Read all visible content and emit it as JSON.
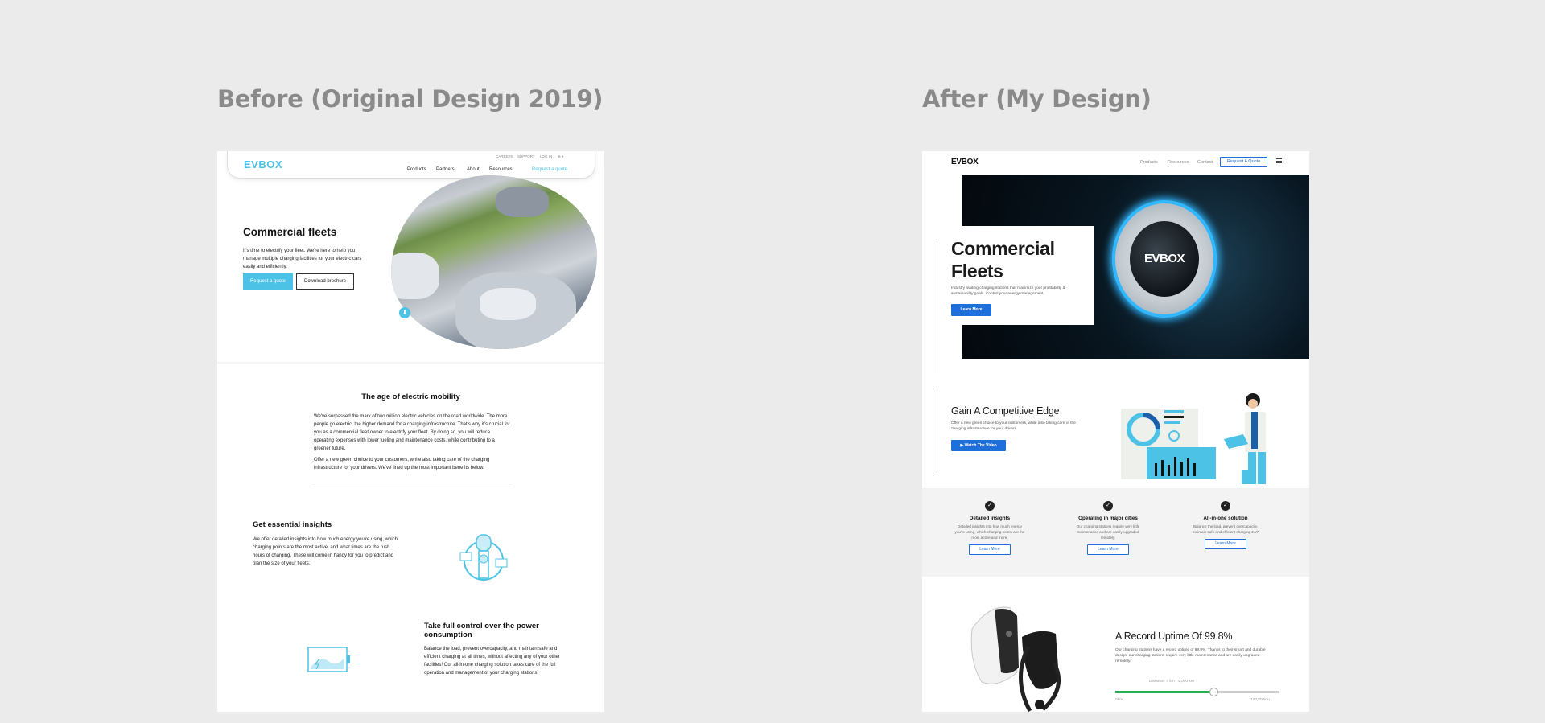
{
  "headings": {
    "before": "Before (Original Design 2019)",
    "after": "After (My Design)"
  },
  "before": {
    "nav": {
      "logo": "EVBOX",
      "utility": [
        "CAREERS",
        "SUPPORT",
        "LOG IN",
        "⊕ ▾"
      ],
      "menu": [
        "Products",
        "Partners",
        "About",
        "Resources",
        "Request a quote"
      ]
    },
    "hero": {
      "title": "Commercial fleets",
      "text": "It's time to electrify your fleet. We're here to help you manage multiple charging facilities for your electric cars easily and efficiently.",
      "primary_button": "Request a quote",
      "secondary_button": "Download brochure"
    },
    "age": {
      "title": "The age of electric mobility",
      "p1": "We've surpassed the mark of two million electric vehicles on the road worldwide. The more people go electric, the higher demand for a charging infrastructure. That's why it's crucial for you as a commercial fleet owner to electrify your fleet. By doing so, you will reduce operating expenses with lower fueling and maintenance costs, while contributing to a greener future.",
      "p2": "Offer a new green choice to your customers, while also taking care of the charging infrastructure for your drivers. We've lined up the most important benefits below."
    },
    "insights": {
      "title": "Get essential insights",
      "text": "We offer detailed insights into how much energy you're using, which charging points are the most active, and what times are the rush hours of charging. These will come in handy for you to predict and plan the size of your fleets."
    },
    "control": {
      "title": "Take full control over the power consumption",
      "text": "Balance the load, prevent overcapacity, and maintain safe and efficient charging at all times, without affecting any of your other facilities! Our all-in-one charging solution takes care of the full operation and management of your charging stations."
    }
  },
  "after": {
    "nav": {
      "logo": "EVBOX",
      "links": [
        "Products",
        "Resources",
        "Contact"
      ],
      "cta": "Request A Quote"
    },
    "hero": {
      "title_line1": "Commercial",
      "title_line2": "Fleets",
      "text": "Industry leading charging stations that maximize your profitability & sustainability goals. Control your energy management.",
      "button": "Learn More",
      "device_logo": "EVBOX"
    },
    "edge": {
      "title": "Gain A Competitive Edge",
      "text": "Offer a new green choice to your customers, while also taking care of the charging infrastructure for your drivers.",
      "button": "▶  Watch The Video"
    },
    "features": [
      {
        "title": "Detailed insights",
        "text": "Detailed insights into how much energy you're using, which charging points are the most active and more.",
        "button": "Learn More"
      },
      {
        "title": "Operating in major cities",
        "text": "Our charging stations require very little maintenance and are easily upgraded remotely.",
        "button": "Learn More"
      },
      {
        "title": "All-in-one solution",
        "text": "Balance the load, prevent overcapacity, maintain safe and efficient charging 24/7",
        "button": "Learn More"
      }
    ],
    "uptime": {
      "title": "A Record Uptime Of 99.8%",
      "text": "Our charging stations have a record uptime of 99.8%. Thanks to their smart and durable design, our charging stations require very little maintenance and are easily upgraded remotely.",
      "slider_label": "Distance: 4 km   ·   4,000 kW",
      "slider_min": "0km",
      "slider_max": "100,000km",
      "slider_level": 0.6
    }
  }
}
